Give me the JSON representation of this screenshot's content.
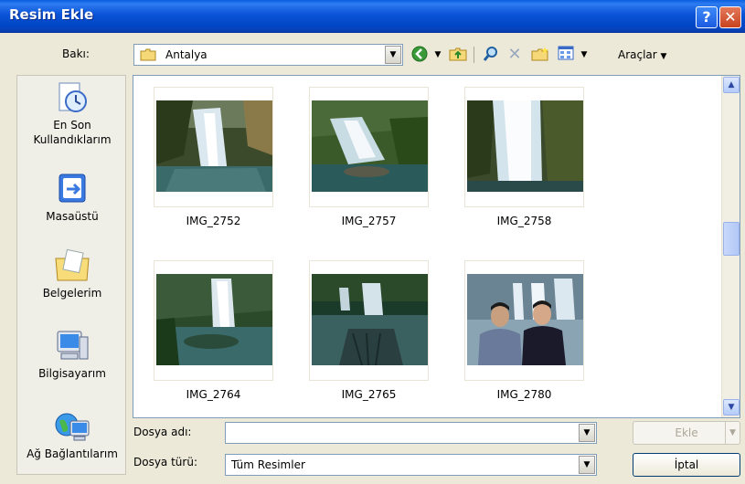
{
  "window": {
    "title": "Resim Ekle",
    "help_label": "?",
    "close_label": "✕"
  },
  "lookin": {
    "label": "Bakı:",
    "value": "Antalya"
  },
  "toolbar": {
    "tools_label": "Araçlar",
    "icons": [
      "back-icon",
      "up-folder-icon",
      "search-web-icon",
      "delete-icon",
      "new-folder-icon",
      "views-icon"
    ]
  },
  "places": [
    {
      "id": "recent",
      "label_line1": "En Son",
      "label_line2": "Kullandıklarım",
      "icon": "recent-documents-icon"
    },
    {
      "id": "desktop",
      "label_line1": "Masaüstü",
      "label_line2": "",
      "icon": "desktop-icon"
    },
    {
      "id": "mydocs",
      "label_line1": "Belgelerim",
      "label_line2": "",
      "icon": "my-documents-icon"
    },
    {
      "id": "computer",
      "label_line1": "Bilgisayarım",
      "label_line2": "",
      "icon": "my-computer-icon"
    },
    {
      "id": "network",
      "label_line1": "Ağ Bağlantılarım",
      "label_line2": "",
      "icon": "network-icon"
    }
  ],
  "files": [
    {
      "name": "IMG_2752"
    },
    {
      "name": "IMG_2757"
    },
    {
      "name": "IMG_2758"
    },
    {
      "name": "IMG_2764"
    },
    {
      "name": "IMG_2765"
    },
    {
      "name": "IMG_2780"
    }
  ],
  "filename": {
    "label": "Dosya adı:",
    "value": ""
  },
  "filetype": {
    "label": "Dosya türü:",
    "value": "Tüm Resimler"
  },
  "buttons": {
    "insert": "Ekle",
    "cancel": "İptal"
  },
  "colors": {
    "titlebar": "#0a54d8",
    "dialog_bg": "#ece9d8",
    "input_border": "#7f9db9"
  }
}
